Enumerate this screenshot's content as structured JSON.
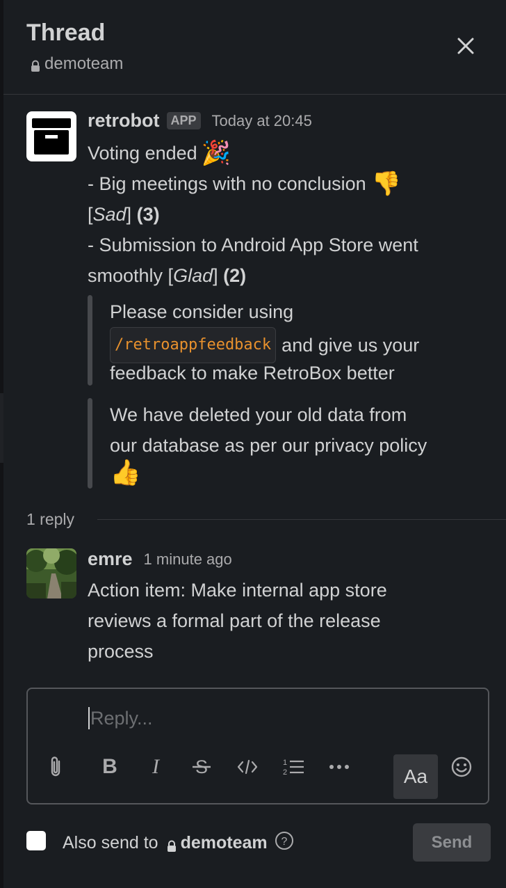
{
  "header": {
    "title": "Thread",
    "channel": "demoteam"
  },
  "bot_message": {
    "name": "retrobot",
    "badge": "APP",
    "time": "Today at 20:45",
    "line1": "Voting ended",
    "line2": "- Big meetings with no conclusion",
    "line3_tag": "Sad",
    "line3_count": "(3)",
    "line4": "- Submission to Android App Store went",
    "line5_text": "smoothly",
    "line5_tag": "Glad",
    "line5_count": "(2)",
    "quote1_line1": "Please consider using",
    "quote1_code": "/retroappfeedback",
    "quote1_after": "and give us your",
    "quote1_line3": "feedback to make RetroBox better",
    "quote2_line1": "We have deleted your old data from",
    "quote2_line2": "our database as per our privacy policy"
  },
  "thread": {
    "reply_count": "1 reply"
  },
  "user_message": {
    "name": "emre",
    "time": "1 minute ago",
    "line1": "Action item: Make internal app store",
    "line2": "reviews a formal part of the release",
    "line3": "process"
  },
  "composer": {
    "placeholder": "Reply...",
    "format_label": "Aa",
    "icons": [
      "paperclip-icon",
      "bold-icon",
      "italic-icon",
      "strikethrough-icon",
      "code-icon",
      "numbered-list-icon",
      "more-icon",
      "emoji-icon"
    ]
  },
  "footer": {
    "also_send_to": "Also send to",
    "channel": "demoteam",
    "send_label": "Send"
  },
  "colors": {
    "background": "#1a1d21",
    "code": "#e8912d",
    "text": "#d1d2d3"
  }
}
